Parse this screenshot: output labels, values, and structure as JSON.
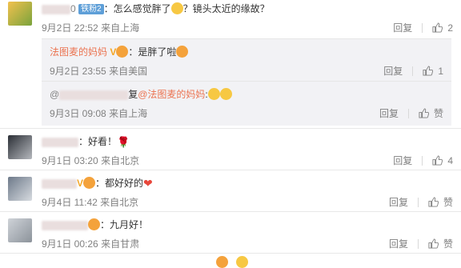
{
  "comments": [
    {
      "text": "：怎么感觉胖了",
      "text2": "？镜头太近的缘故？",
      "badge": "铁粉2",
      "prefix": "0",
      "time": "9月2日 22:52",
      "source": "来自上海",
      "reply_label": "回复",
      "like_count": "2"
    },
    {
      "text": "：好看！",
      "time": "9月1日 03:20",
      "source": "来自北京",
      "reply_label": "回复",
      "like_count": "4"
    },
    {
      "text": "：都好好的",
      "time": "9月4日 11:42",
      "source": "来自北京",
      "reply_label": "回复",
      "like_count": "赞"
    },
    {
      "text": "：九月好！",
      "time": "9月1日 00:26",
      "source": "来自甘肃",
      "reply_label": "回复",
      "like_count": "赞"
    }
  ],
  "replies": [
    {
      "name": "法图麦的妈妈",
      "text": "：是胖了啦",
      "time": "9月2日 23:55",
      "source": "来自美国",
      "reply_label": "回复",
      "like_count": "1"
    },
    {
      "prefix": "@",
      "reply_word": "复",
      "mention": "@法图麦的妈妈",
      "colon": ":",
      "time": "9月3日 09:08",
      "source": "来自上海",
      "reply_label": "回复",
      "like_count": "赞"
    }
  ],
  "icons": {
    "like": "thumbs-up-icon",
    "vip": "v-badge-icon"
  },
  "colors": {
    "accent": "#eb7350",
    "meta": "#808080",
    "reply_bg": "#f2f2f5"
  }
}
